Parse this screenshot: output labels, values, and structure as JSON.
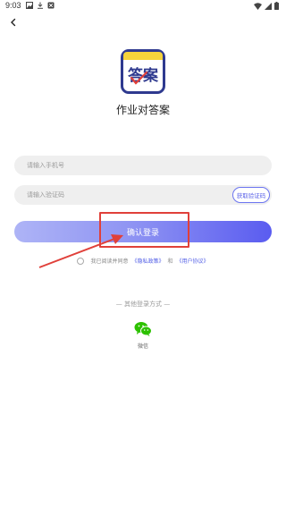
{
  "status_bar": {
    "time": "9:03"
  },
  "app": {
    "logo_text": "答案",
    "name": "作业对答案"
  },
  "form": {
    "phone_placeholder": "请输入手机号",
    "code_placeholder": "请输入验证码",
    "get_code_label": "获取验证码",
    "login_label": "确认登录"
  },
  "agreement": {
    "prefix": "我已阅读并同意",
    "privacy": "《隐私政策》",
    "and": "和",
    "terms": "《用户协议》"
  },
  "other_login": {
    "title": "— 其他登录方式 —",
    "wechat_label": "微信"
  },
  "colors": {
    "accent": "#5a5cf0",
    "logo_border": "#2f3a8f",
    "logo_band": "#f5d33b",
    "highlight": "#e0403a",
    "wechat": "#2dc100"
  }
}
